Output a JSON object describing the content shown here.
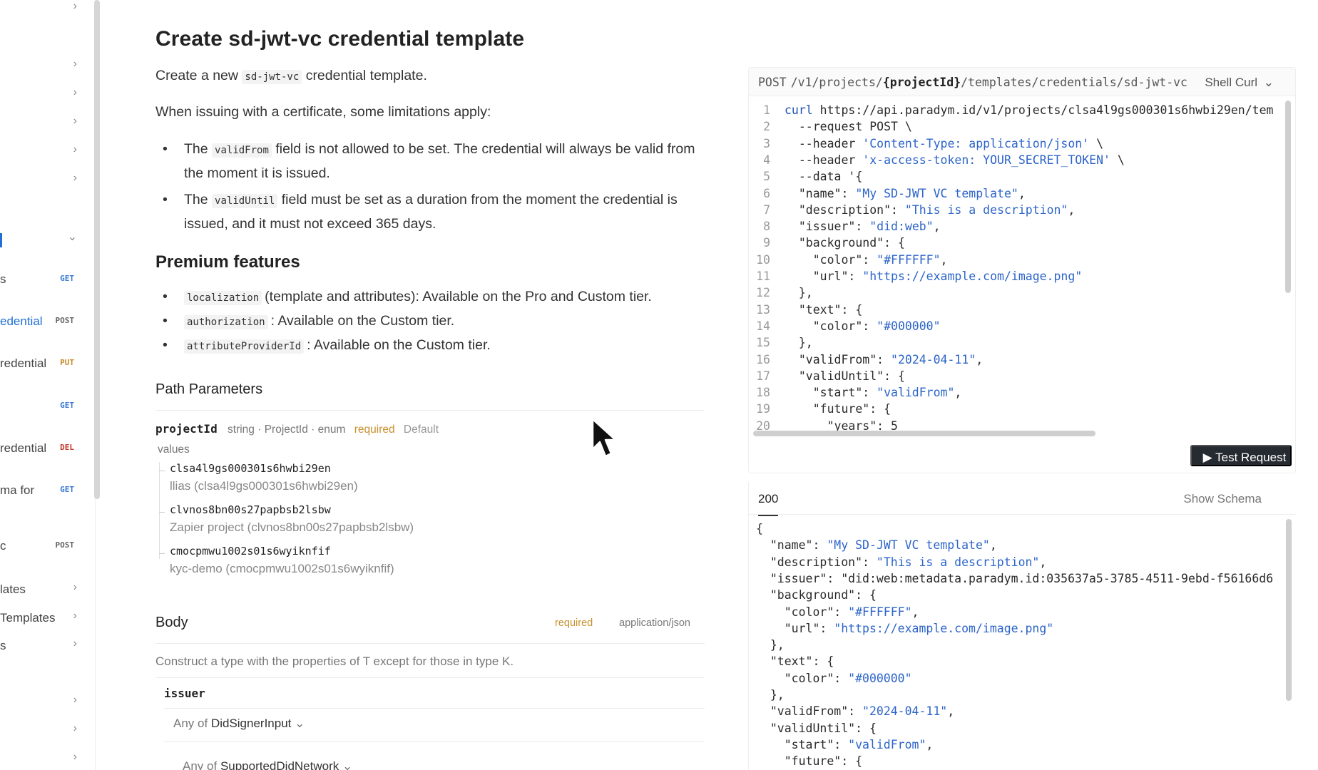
{
  "sidebar": {
    "rows": [
      {
        "label": "",
        "kind": "chev",
        "chev": "›"
      },
      {
        "label": "",
        "kind": "chev",
        "chev": "›"
      },
      {
        "label": "",
        "kind": "chev",
        "chev": "›"
      },
      {
        "label": "",
        "kind": "chev",
        "chev": "›"
      },
      {
        "label": "",
        "kind": "chev",
        "chev": "›"
      },
      {
        "label": "",
        "kind": "chev",
        "chev": "›"
      },
      {
        "label": "",
        "kind": "chev",
        "chev": "⌄"
      },
      {
        "label": "s",
        "kind": "method",
        "method": "GET"
      },
      {
        "label": "edential",
        "kind": "method",
        "method": "POST",
        "active": true
      },
      {
        "label": "redential",
        "kind": "method",
        "method": "PUT"
      },
      {
        "label": "",
        "kind": "method",
        "method": "GET"
      },
      {
        "label": "redential",
        "kind": "method",
        "method": "DEL"
      },
      {
        "label": "ma for",
        "kind": "method",
        "method": "GET"
      },
      {
        "label": "c",
        "kind": "method",
        "method": "POST"
      },
      {
        "label": "lates",
        "kind": "chev",
        "chev": "›"
      },
      {
        "label": "Templates",
        "kind": "chev",
        "chev": "›"
      },
      {
        "label": "s",
        "kind": "chev",
        "chev": "›"
      },
      {
        "label": "",
        "kind": "chev",
        "chev": "›"
      },
      {
        "label": "",
        "kind": "chev",
        "chev": "›"
      },
      {
        "label": "",
        "kind": "chev",
        "chev": "›"
      }
    ]
  },
  "main": {
    "title": "Create sd-jwt-vc credential template",
    "intro_pre": "Create a new",
    "intro_code": "sd-jwt-vc",
    "intro_post": "credential template.",
    "cert_note": "When issuing with a certificate, some limitations apply:",
    "limitations": [
      {
        "pre": "The",
        "code": "validFrom",
        "post": "field is not allowed to be set. The credential will always be valid from the moment it is issued."
      },
      {
        "pre": "The",
        "code": "validUntil",
        "post": "field must be set as a duration from the moment the credential is issued, and it must not exceed 365 days."
      }
    ],
    "premium_title": "Premium features",
    "premium": [
      {
        "code": "localization",
        "post": "(template and attributes): Available on the Pro and Custom tier."
      },
      {
        "code": "authorization",
        "post": ": Available on the Custom tier."
      },
      {
        "code": "attributeProviderId",
        "post": ": Available on the Custom tier."
      }
    ],
    "path_params_title": "Path Parameters",
    "param": {
      "name": "projectId",
      "meta": "string · ProjectId · enum",
      "required": "required",
      "default": "Default",
      "values_label": "values",
      "values": [
        {
          "value": "clsa4l9gs000301s6hwbi29en",
          "desc": "llias (clsa4l9gs000301s6hwbi29en)"
        },
        {
          "value": "clvnos8bn00s27papbsb2lsbw",
          "desc": "Zapier project (clvnos8bn00s27papbsb2lsbw)"
        },
        {
          "value": "cmocpmwu1002s01s6wyiknfif",
          "desc": "kyc-demo (cmocpmwu1002s01s6wyiknfif)"
        }
      ]
    },
    "body": {
      "title": "Body",
      "required": "required",
      "content_type": "application/json",
      "description": "Construct a type with the properties of T except for those in type K.",
      "field": "issuer",
      "anyof_1_pre": "Any of",
      "anyof_1_type": "DidSignerInput",
      "anyof_2_pre": "Any of",
      "anyof_2_type": "SupportedDidNetwork"
    }
  },
  "request": {
    "method": "POST",
    "path_pre": "/v1/projects/",
    "path_param": "{projectId}",
    "path_post": "/templates/credentials/sd-jwt-vc",
    "language": "Shell Curl",
    "test_button": "Test Request",
    "lines": [
      "curl https://api.paradym.id/v1/projects/clsa4l9gs000301s6hwbi29en/tem",
      "  --request POST \\",
      "  --header 'Content-Type: application/json' \\",
      "  --header 'x-access-token: YOUR_SECRET_TOKEN' \\",
      "  --data '{",
      "  \"name\": \"My SD-JWT VC template\",",
      "  \"description\": \"This is a description\",",
      "  \"issuer\": \"did:web\",",
      "  \"background\": {",
      "    \"color\": \"#FFFFFF\",",
      "    \"url\": \"https://example.com/image.png\"",
      "  },",
      "  \"text\": {",
      "    \"color\": \"#000000\"",
      "  },",
      "  \"validFrom\": \"2024-04-11\",",
      "  \"validUntil\": {",
      "    \"start\": \"validFrom\",",
      "    \"future\": {",
      "      \"years\": 5"
    ]
  },
  "response": {
    "status_tab": "200",
    "show_schema": "Show Schema",
    "lines": [
      "{",
      "  \"name\": \"My SD-JWT VC template\",",
      "  \"description\": \"This is a description\",",
      "  \"issuer\": \"did:web:metadata.paradym.id:035637a5-3785-4511-9ebd-f56166d6",
      "  \"background\": {",
      "    \"color\": \"#FFFFFF\",",
      "    \"url\": \"https://example.com/image.png\"",
      "  },",
      "  \"text\": {",
      "    \"color\": \"#000000\"",
      "  },",
      "  \"validFrom\": \"2024-04-11\",",
      "  \"validUntil\": {",
      "    \"start\": \"validFrom\",",
      "    \"future\": {"
    ]
  },
  "colors": {
    "accent": "#1f6fd6",
    "required": "#c8902e",
    "string": "#2c64c9",
    "button_bg": "#262a31"
  },
  "icons": {
    "chevron_right": "chevron-right-icon",
    "chevron_down": "chevron-down-icon",
    "play": "play-icon",
    "cursor": "mouse-cursor-icon"
  }
}
